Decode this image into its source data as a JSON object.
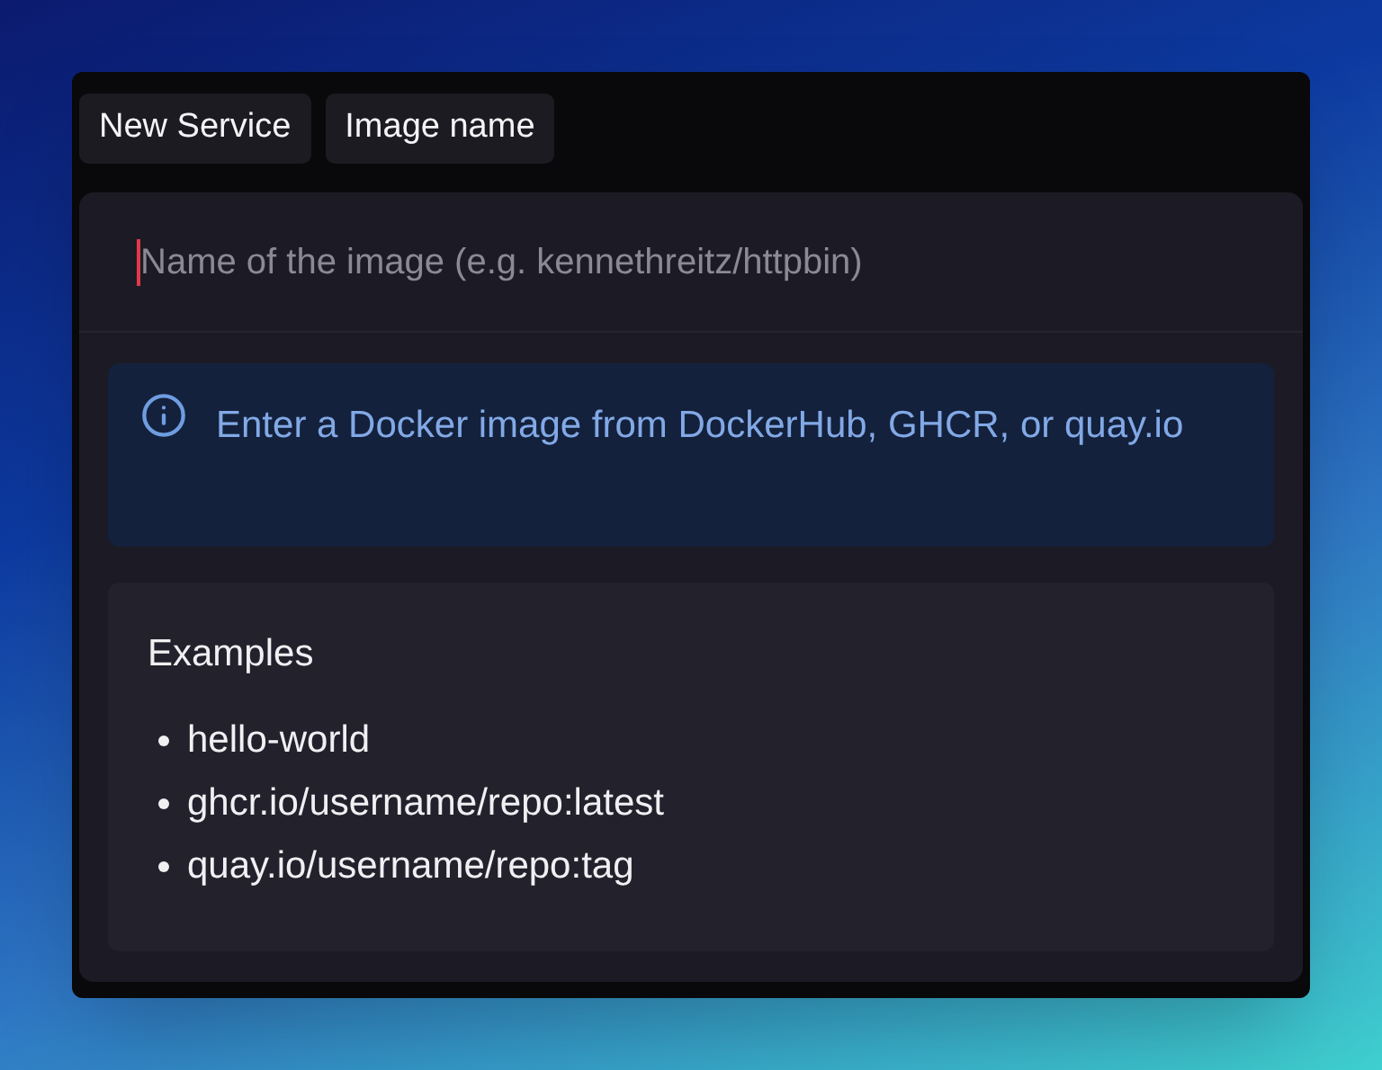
{
  "breadcrumb": [
    {
      "label": "New Service"
    },
    {
      "label": "Image name"
    }
  ],
  "image_field": {
    "placeholder": "Name of the image (e.g. kennethreitz/httpbin)"
  },
  "info": {
    "text": "Enter a Docker image from DockerHub, GHCR, or quay.io"
  },
  "examples": {
    "title": "Examples",
    "items": [
      "hello-world",
      "ghcr.io/username/repo:latest",
      "quay.io/username/repo:tag"
    ]
  }
}
